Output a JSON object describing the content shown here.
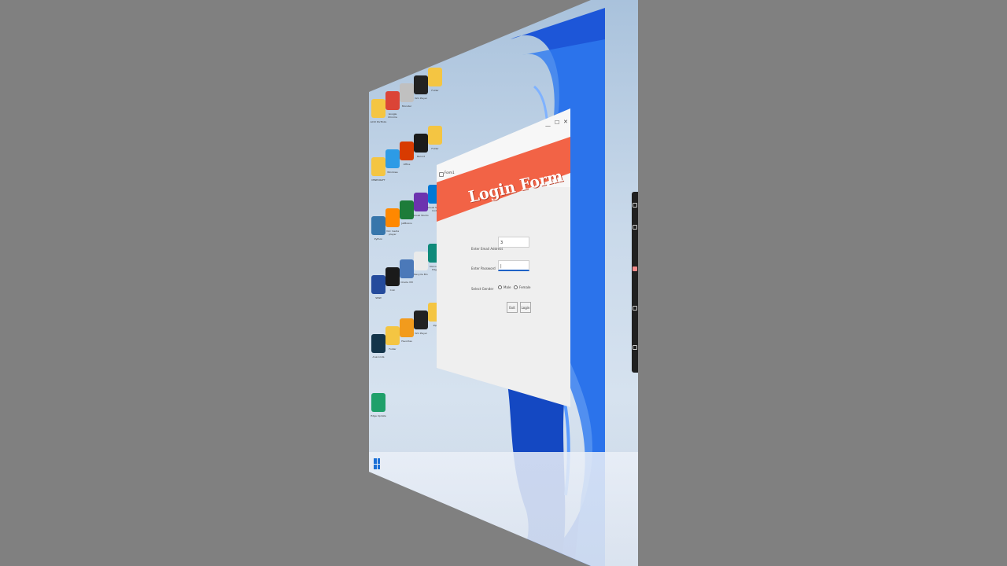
{
  "window": {
    "title": "Form1",
    "banner_title": "Login Form",
    "controls": {
      "minimize": "—",
      "maximize": "☐",
      "close": "✕"
    }
  },
  "form": {
    "email_label": "Enter Email Address",
    "email_value": "3",
    "password_label": "Enter Password",
    "password_value": "|",
    "gender_label": "Select Gender",
    "gender_options": [
      "Male",
      "Female"
    ],
    "exit_button": "Exit",
    "login_button": "Login"
  },
  "desktop": {
    "icons": [
      {
        "label": "ACtrl Portfolio",
        "color": "#f4c542"
      },
      {
        "label": "Google Chrome",
        "color": "#db4437"
      },
      {
        "label": "Monster",
        "color": "#c0c0c0"
      },
      {
        "label": "321 Player",
        "color": "#222222"
      },
      {
        "label": "Folder",
        "color": "#f4c542"
      },
      {
        "label": "MINECRAFT",
        "color": "#f4c542"
      },
      {
        "label": "Windows",
        "color": "#2d9be6"
      },
      {
        "label": "Office",
        "color": "#d83b01"
      },
      {
        "label": "Record",
        "color": "#1b1b1b"
      },
      {
        "label": "Folder",
        "color": "#f4c542"
      },
      {
        "label": "Python",
        "color": "#3776ab"
      },
      {
        "label": "VLC media player",
        "color": "#ff8800"
      },
      {
        "label": "JetBrains",
        "color": "#1d7c3a"
      },
      {
        "label": "Visual Studio",
        "color": "#6c33af"
      },
      {
        "label": "Visual Studio Code",
        "color": "#0078d4"
      },
      {
        "label": "SMW",
        "color": "#244b9c"
      },
      {
        "label": "Coin",
        "color": "#1a1a1a"
      },
      {
        "label": "Oracle VM",
        "color": "#4b79b9"
      },
      {
        "label": "Recycle Bin",
        "color": "#eaeaea"
      },
      {
        "label": "Microsoft Edge",
        "color": "#0f8a7a"
      },
      {
        "label": "Anaconda",
        "color": "#13344a"
      },
      {
        "label": "Folder",
        "color": "#f4c542"
      },
      {
        "label": "Favorites",
        "color": "#f29b1d"
      },
      {
        "label": "321 Player",
        "color": "#222222"
      },
      {
        "label": "Zip",
        "color": "#f4c542"
      },
      {
        "label": "Edge Update",
        "color": "#1fa06a"
      }
    ]
  },
  "colors": {
    "banner": "#f26346",
    "wallpaper_blue": "#1e5fe0",
    "accent": "#1f63c7"
  }
}
